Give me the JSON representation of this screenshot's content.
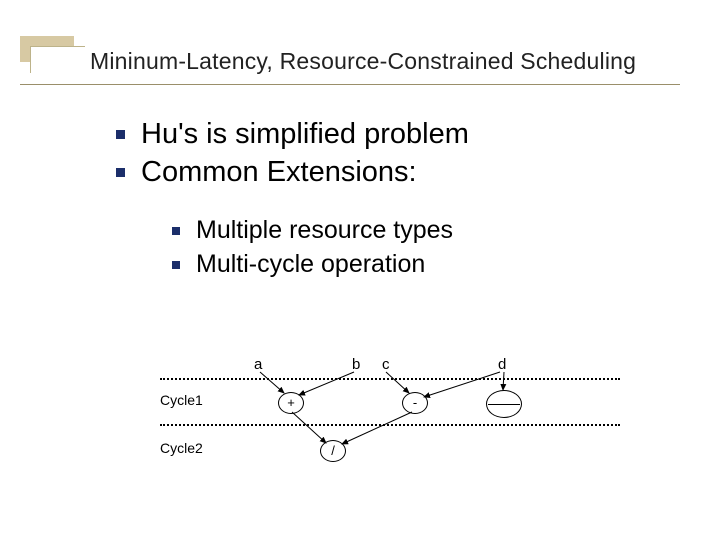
{
  "title": "Mininum-Latency, Resource-Constrained Scheduling",
  "bullets": {
    "b1": "Hu's is simplified problem",
    "b2": "Common Extensions:",
    "s1": "Multiple resource types",
    "s2": "Multi-cycle operation"
  },
  "diagram": {
    "cycle1": "Cycle1",
    "cycle2": "Cycle2",
    "a": "a",
    "b": "b",
    "c": "c",
    "d": "d",
    "plus": "+",
    "minus": "-",
    "slash": "/"
  }
}
